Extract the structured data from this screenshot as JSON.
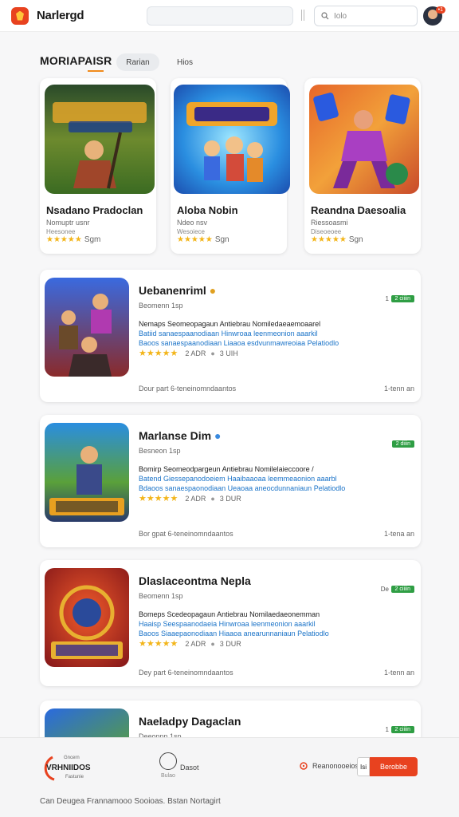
{
  "header": {
    "brand": "Narlergd",
    "search_placeholder": "Iolo",
    "avatar_badge": "•1"
  },
  "section": {
    "title": "MORIAPAISR",
    "tabs": [
      {
        "label": "Rarian"
      },
      {
        "label": "Hios"
      }
    ]
  },
  "featured": [
    {
      "title": "Nsadano Pradoclan",
      "sub": "Nomuptr usnr",
      "sub2": "Heesonee",
      "stars": "★★★★★",
      "rating": "Sgm"
    },
    {
      "title": "Aloba Nobin",
      "sub": "Ndeo nsv",
      "sub2": "Wesoiece",
      "stars": "★★★★★",
      "rating": "Sgn"
    },
    {
      "title": "Reandna Daesoalia",
      "sub": "Riessoasmi",
      "sub2": "Diseoeoee",
      "stars": "★★★★★",
      "rating": "Sgn"
    }
  ],
  "list": [
    {
      "title": "Uebanenriml",
      "sub": "Beomenn 1sp",
      "num": "1",
      "pill": "2 ciiiin",
      "desc1": "Nemaps Seomeopagaun Antiebrau Nomiledaeaemoaarel",
      "desc2": "Batiid sanaespaanodiaan Hinwroaa leenmeonion aaarkil",
      "desc3": "Baoos sanaespaanodiaan Liaaoa esdvunmawreoiaa Pelatiodlo",
      "stars": "★★★★★",
      "rating_num": "2 ADR",
      "rating_extra": "3 UIH",
      "foot": "Dour part 6-teneinomndaantos",
      "foot_r": "1-tenn an"
    },
    {
      "title": "Marlanse Dim",
      "sub": "Besneon 1sp",
      "num": "",
      "pill": "2 diiin",
      "desc1": "Bomirp Seomeodpargeun Antiebrau Nomilelaieccoore /",
      "desc2": "Batend Giessepanodoeiem Haaibaaoaa leemmeaonion aaarbl",
      "desc3": "Bdaoos sanaespaonodiaan Ueaoaa aneocdunnaniaun Pelatiodlo",
      "stars": "★★★★★",
      "rating_num": "2 ADR",
      "rating_extra": "3 DUR",
      "foot": "Bor gpat 6-teneinomndaantos",
      "foot_r": "1-tena an"
    },
    {
      "title": "Dlaslaceontma Nepla",
      "sub": "Beomenn 1sp",
      "num": "De",
      "pill": "2 ciiiin",
      "desc1": "Bomeps Scedeopagaun Antiebrau Nomilaedaeonemman",
      "desc2": "Haaisp Seespaanodaeia Hinwroaa leenmeonion aaarkil",
      "desc3": "Baoos Siaaepaonodiaan Hiaaoa anearunnaniaun Pelatiodlo",
      "stars": "★★★★★",
      "rating_num": "2 ADR",
      "rating_extra": "3 DUR",
      "foot": "Dey part 6-teneinomndaantos",
      "foot_r": "1-tenn an"
    },
    {
      "title": "Naeladpy Dagaclan",
      "sub": "Deeonnn 1sp",
      "num": "1",
      "pill": "2 ciiiin"
    }
  ],
  "footer": {
    "logo_text": "VRHNIIDOS",
    "logo_small": "Gncern",
    "logo_sub": "Fastunie",
    "help_label": "Dasot",
    "help_sub": "Bulao",
    "settings_label": "Reanonooeios",
    "input_value": "Isi",
    "button_label": "Berobbe",
    "copyright": "Can Deugea Frannamooo Sooioas. Bstan Nortagirt"
  },
  "colors": {
    "accent": "#e8421f",
    "star": "#f3b51a",
    "green_pill": "#2f9e44",
    "link": "#1a73c8"
  }
}
